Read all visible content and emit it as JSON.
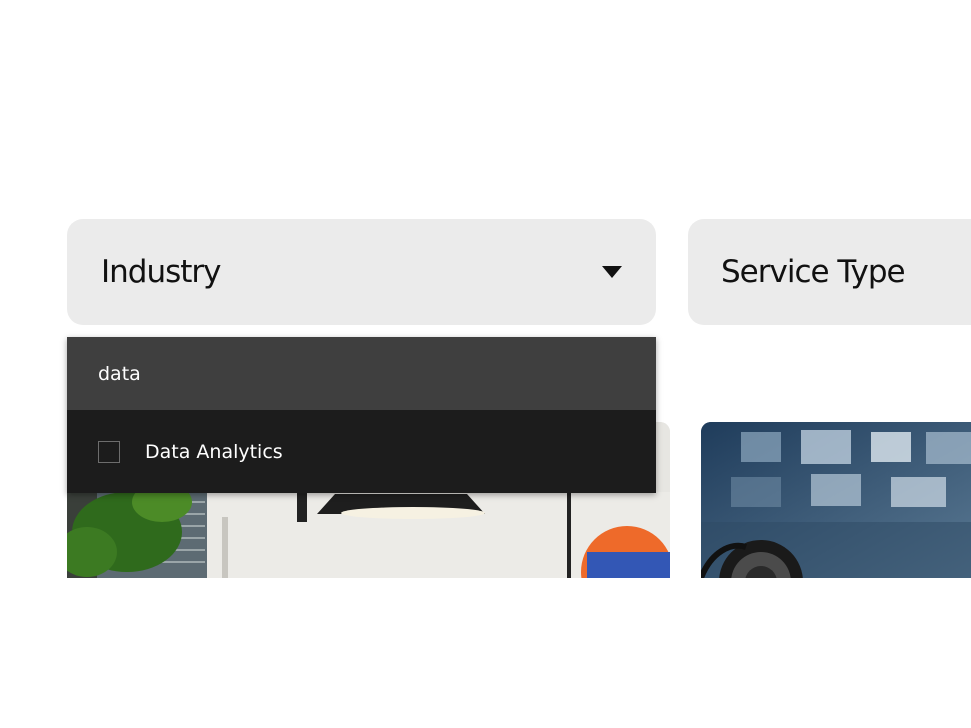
{
  "filters": {
    "industry": {
      "label": "Industry",
      "icon": "triangle-down-icon"
    },
    "service_type": {
      "label": "Service Type"
    }
  },
  "dropdown": {
    "search_value": "data",
    "options": [
      {
        "label": "Data Analytics",
        "checked": false
      }
    ]
  },
  "colors": {
    "filter_bg": "#ebebeb",
    "dropdown_bg": "#1c1c1c",
    "search_bg": "#3f3f3f"
  }
}
